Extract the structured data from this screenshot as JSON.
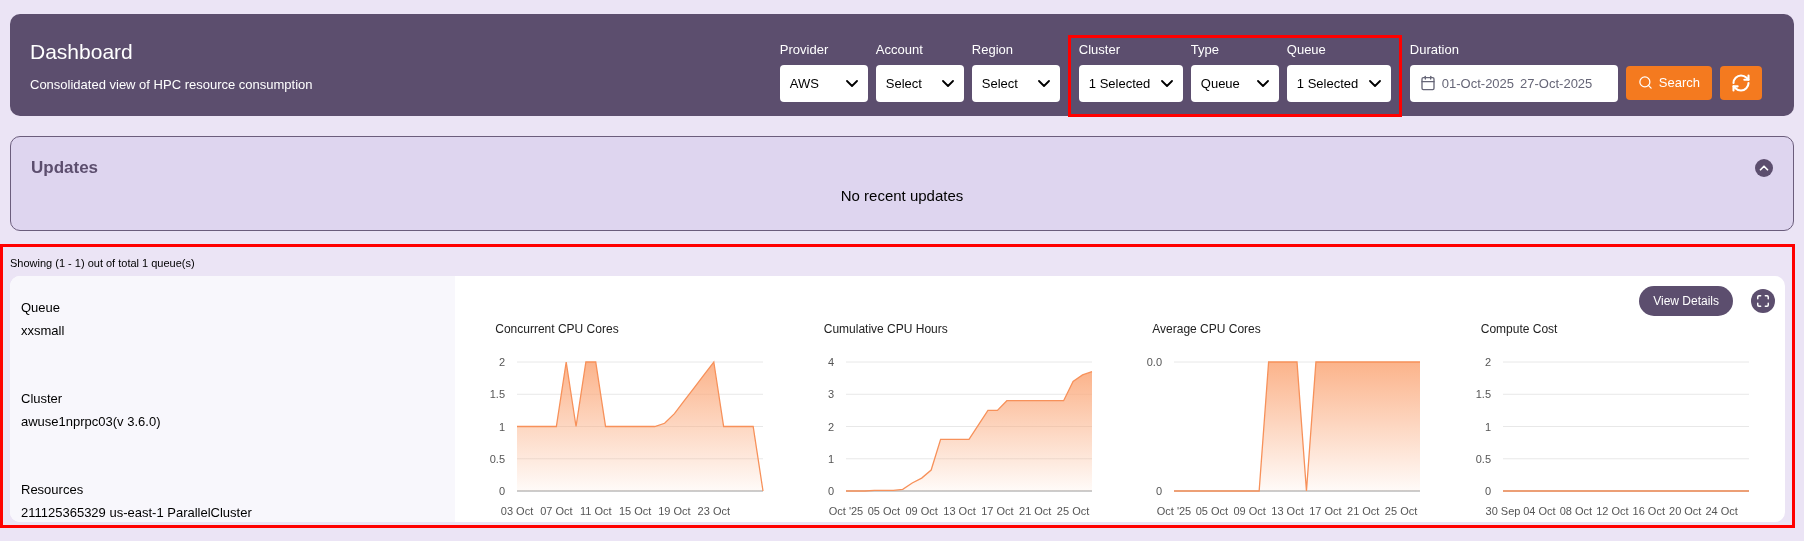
{
  "header": {
    "title": "Dashboard",
    "subtitle": "Consolidated view of HPC resource consumption",
    "filters": [
      {
        "label": "Provider",
        "value": "AWS",
        "highlighted": false
      },
      {
        "label": "Account",
        "value": "Select",
        "highlighted": false
      },
      {
        "label": "Region",
        "value": "Select",
        "highlighted": false
      },
      {
        "label": "Cluster",
        "value": "1 Selected",
        "highlighted": true
      },
      {
        "label": "Type",
        "value": "Queue",
        "highlighted": true
      },
      {
        "label": "Queue",
        "value": "1 Selected",
        "highlighted": true
      }
    ],
    "duration": {
      "label": "Duration",
      "start": "01-Oct-2025",
      "end": "27-Oct-2025"
    },
    "search_button": "Search"
  },
  "updates": {
    "title": "Updates",
    "expanded": true,
    "message": "No recent updates"
  },
  "queues": {
    "highlighted": true,
    "summary": "Showing (1 - 1) out of total 1 queue(s)",
    "cards": [
      {
        "details": [
          {
            "label": "Queue",
            "value": "xxsmall"
          },
          {
            "label": "Cluster",
            "value": "awuse1nprpc03(v 3.6.0)"
          },
          {
            "label": "Resources",
            "value": "211125365329 us-east-1 ParallelCluster"
          }
        ],
        "view_button": "View Details",
        "charts": [
          {
            "chart_data": {
              "type": "area",
              "grid": true,
              "title": "Concurrent CPU Cores",
              "categories": [
                "03 Oct",
                null,
                null,
                null,
                "07 Oct",
                null,
                null,
                null,
                "11 Oct",
                null,
                null,
                null,
                "15 Oct",
                null,
                null,
                null,
                "19 Oct",
                null,
                null,
                null,
                "23 Oct",
                null,
                null,
                null,
                null,
                null
              ],
              "values": [
                1,
                1,
                1,
                1,
                1,
                2,
                1,
                2,
                2,
                1,
                1,
                1,
                1,
                1,
                1,
                1.05,
                1.2,
                1.4,
                1.6,
                1.8,
                2,
                1,
                1,
                1,
                1,
                0
              ],
              "ylim": [
                0,
                2
              ],
              "yticks": [
                0,
                0.5,
                1,
                1.5,
                2
              ]
            }
          },
          {
            "chart_data": {
              "type": "area",
              "grid": true,
              "title": "Cumulative CPU Hours",
              "categories": [
                "Oct '25",
                null,
                null,
                null,
                "05 Oct",
                null,
                null,
                null,
                "09 Oct",
                null,
                null,
                null,
                "13 Oct",
                null,
                null,
                null,
                "17 Oct",
                null,
                null,
                null,
                "21 Oct",
                null,
                null,
                null,
                "25 Oct",
                null,
                null
              ],
              "values": [
                0,
                0,
                0,
                0.02,
                0.02,
                0.02,
                0.05,
                0.25,
                0.4,
                0.65,
                1.6,
                1.6,
                1.6,
                1.6,
                2.05,
                2.5,
                2.5,
                2.8,
                2.8,
                2.8,
                2.8,
                2.8,
                2.8,
                2.8,
                3.4,
                3.6,
                3.7
              ],
              "ylim": [
                0,
                4
              ],
              "yticks": [
                0,
                1,
                2,
                3,
                4
              ]
            }
          },
          {
            "chart_data": {
              "type": "area",
              "grid": true,
              "title": "Average CPU Cores",
              "categories": [
                "Oct '25",
                null,
                null,
                null,
                "05 Oct",
                null,
                null,
                null,
                "09 Oct",
                null,
                null,
                null,
                "13 Oct",
                null,
                null,
                null,
                "17 Oct",
                null,
                null,
                null,
                "21 Oct",
                null,
                null,
                null,
                "25 Oct",
                null,
                null
              ],
              "values": [
                0,
                0,
                0,
                0,
                0,
                0,
                0,
                0,
                0,
                0,
                0.04,
                0.04,
                0.04,
                0.04,
                0,
                0.04,
                0.04,
                0.04,
                0.04,
                0.04,
                0.04,
                0.04,
                0.04,
                0.04,
                0.04,
                0.04,
                0.04
              ],
              "ylim": [
                0,
                0.04
              ],
              "yticks": [
                {
                  "value": 0,
                  "label": "0"
                },
                {
                  "value": 0.04,
                  "label": "0.0"
                }
              ]
            }
          },
          {
            "chart_data": {
              "type": "line",
              "grid": true,
              "title": "Compute Cost",
              "categories": [
                "30 Sep",
                null,
                null,
                null,
                "04 Oct",
                null,
                null,
                null,
                "08 Oct",
                null,
                null,
                null,
                "12 Oct",
                null,
                null,
                null,
                "16 Oct",
                null,
                null,
                null,
                "20 Oct",
                null,
                null,
                null,
                "24 Oct",
                null,
                null,
                null
              ],
              "values": [
                0,
                0,
                0,
                0,
                0,
                0,
                0,
                0,
                0,
                0,
                0,
                0,
                0,
                0,
                0,
                0,
                0,
                0,
                0,
                0,
                0,
                0,
                0,
                0,
                0,
                0,
                0,
                0
              ],
              "ylim": [
                0,
                2
              ],
              "yticks": [
                0,
                0.5,
                1,
                1.5,
                2
              ]
            }
          }
        ]
      }
    ]
  }
}
